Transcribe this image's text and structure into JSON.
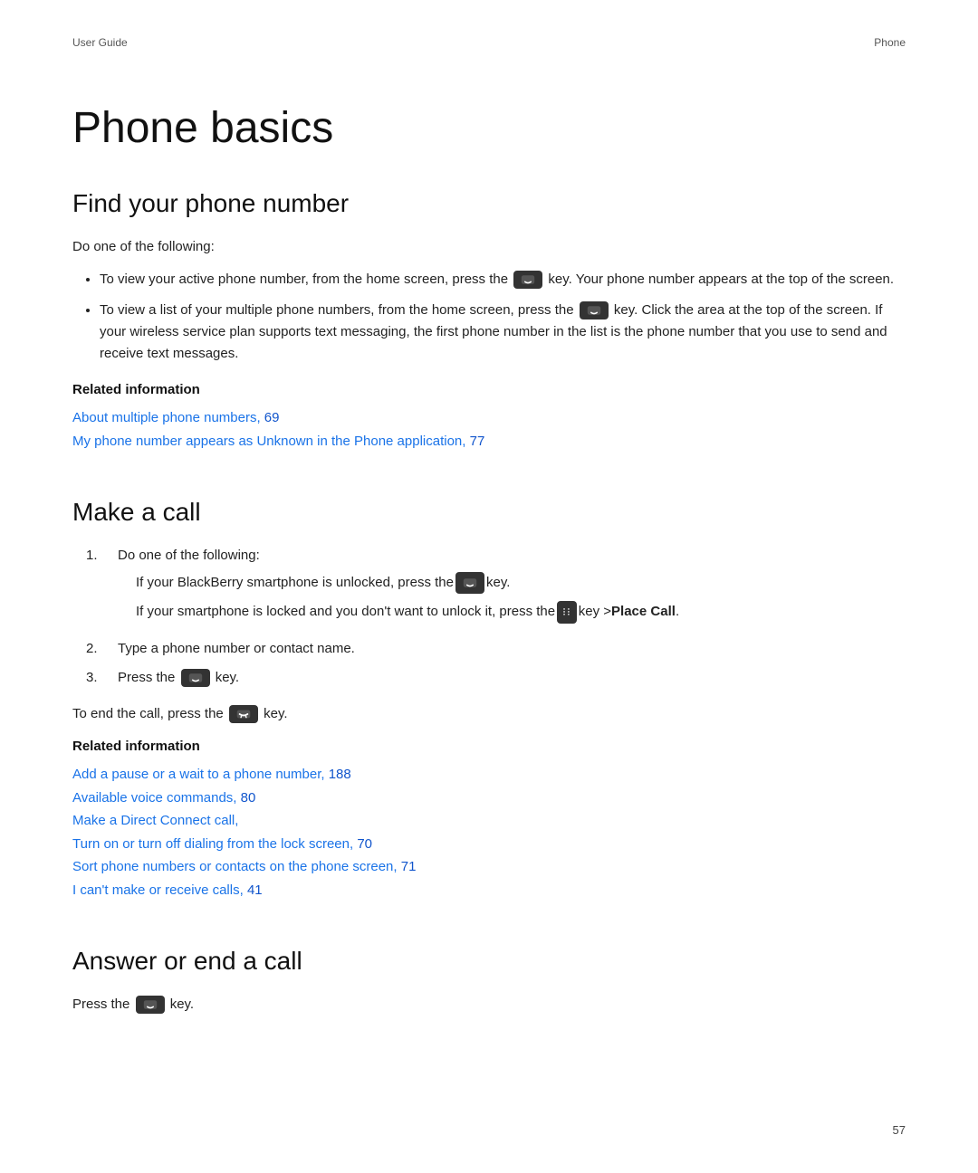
{
  "header": {
    "left": "User Guide",
    "right": "Phone"
  },
  "page_title": "Phone basics",
  "sections": [
    {
      "id": "find-phone-number",
      "heading": "Find your phone number",
      "intro": "Do one of the following:",
      "bullets": [
        "To view your active phone number, from the home screen, press the [phone_key] key. Your phone number appears at the top of the screen.",
        "To view a list of your multiple phone numbers, from the home screen, press the [phone_key] key. Click the area at the top of the screen. If your wireless service plan supports text messaging, the first phone number in the list is the phone number that you use to send and receive text messages."
      ],
      "related_heading": "Related information",
      "related_links": [
        {
          "text": "About multiple phone numbers,",
          "page": " 69"
        },
        {
          "text": "My phone number appears as Unknown in the Phone application,",
          "page": " 77"
        }
      ]
    },
    {
      "id": "make-a-call",
      "heading": "Make a call",
      "steps": [
        {
          "number": "1.",
          "text": "Do one of the following:",
          "sub_bullets": [
            "If your BlackBerry smartphone is unlocked, press the [phone_key] key.",
            "If your smartphone is locked and you don't want to unlock it, press the [menu_key] key > Place Call."
          ]
        },
        {
          "number": "2.",
          "text": "Type a phone number or contact name."
        },
        {
          "number": "3.",
          "text": "Press the [phone_key] key."
        }
      ],
      "end_call_text": "To end the call, press the [end_key] key.",
      "related_heading": "Related information",
      "related_links": [
        {
          "text": "Add a pause or a wait to a phone number,",
          "page": " 188"
        },
        {
          "text": "Available voice commands,",
          "page": " 80"
        },
        {
          "text": "Make a Direct Connect call,",
          "page": ""
        },
        {
          "text": "Turn on or turn off dialing from the lock screen,",
          "page": " 70"
        },
        {
          "text": "Sort phone numbers or contacts on the phone screen,",
          "page": " 71"
        },
        {
          "text": "I can't make or receive calls,",
          "page": " 41"
        }
      ]
    },
    {
      "id": "answer-end-call",
      "heading": "Answer or end a call",
      "text": "Press the [phone_key] key."
    }
  ],
  "page_number": "57",
  "place_call_bold": "Place Call"
}
